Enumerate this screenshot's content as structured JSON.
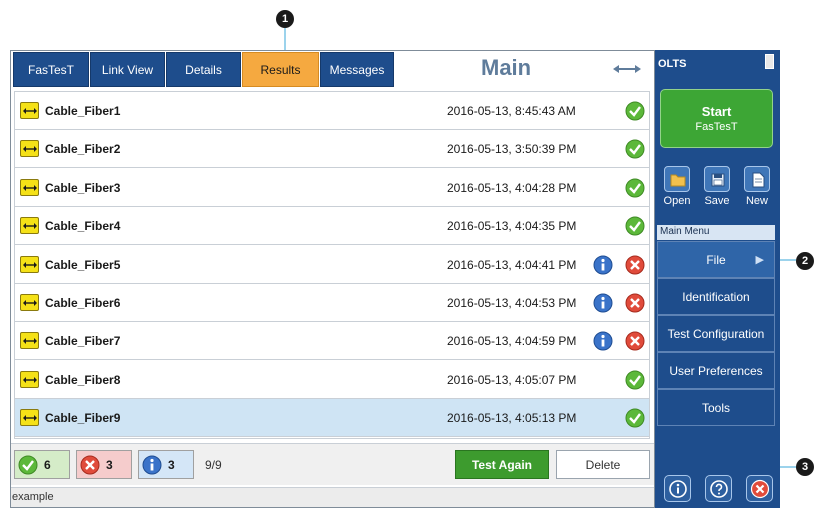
{
  "tabs": [
    {
      "label": "FasTesT"
    },
    {
      "label": "Link View"
    },
    {
      "label": "Details"
    },
    {
      "label": "Results"
    },
    {
      "label": "Messages"
    }
  ],
  "active_tab": "Results",
  "main_title": "Main",
  "results": [
    {
      "name": "Cable_Fiber1",
      "date": "2016-05-13, 8:45:43 AM",
      "status": "pass",
      "info": false
    },
    {
      "name": "Cable_Fiber2",
      "date": "2016-05-13, 3:50:39 PM",
      "status": "pass",
      "info": false
    },
    {
      "name": "Cable_Fiber3",
      "date": "2016-05-13, 4:04:28 PM",
      "status": "pass",
      "info": false
    },
    {
      "name": "Cable_Fiber4",
      "date": "2016-05-13, 4:04:35 PM",
      "status": "pass",
      "info": false
    },
    {
      "name": "Cable_Fiber5",
      "date": "2016-05-13, 4:04:41 PM",
      "status": "fail",
      "info": true
    },
    {
      "name": "Cable_Fiber6",
      "date": "2016-05-13, 4:04:53 PM",
      "status": "fail",
      "info": true
    },
    {
      "name": "Cable_Fiber7",
      "date": "2016-05-13, 4:04:59 PM",
      "status": "fail",
      "info": true
    },
    {
      "name": "Cable_Fiber8",
      "date": "2016-05-13, 4:05:07 PM",
      "status": "pass",
      "info": false
    },
    {
      "name": "Cable_Fiber9",
      "date": "2016-05-13, 4:05:13 PM",
      "status": "pass",
      "info": false,
      "selected": true
    }
  ],
  "footer": {
    "pass_count": "6",
    "fail_count": "3",
    "info_count": "3",
    "page_count": "9/9",
    "test_again_label": "Test Again",
    "delete_label": "Delete"
  },
  "status_line": "example",
  "sidebar": {
    "title": "OLTS",
    "start_label": "Start",
    "start_sublabel": "FasTesT",
    "tools": [
      {
        "label": "Open",
        "icon": "folder-open-icon"
      },
      {
        "label": "Save",
        "icon": "floppy-disk-icon"
      },
      {
        "label": "New",
        "icon": "new-document-icon"
      }
    ],
    "menu_header": "Main Menu",
    "menu_items": [
      {
        "label": "File"
      },
      {
        "label": "Identification"
      },
      {
        "label": "Test Configuration"
      },
      {
        "label": "User Preferences"
      },
      {
        "label": "Tools"
      }
    ]
  },
  "callouts": [
    "1",
    "2",
    "3"
  ],
  "colors": {
    "tab_blue": "#1e4d8c",
    "active_tab_orange": "#f5a940",
    "pass_green": "#5cb83a",
    "fail_red": "#e04b3b",
    "info_blue": "#3a73c9",
    "start_green": "#3da635",
    "selected_row": "#cfe4f4"
  }
}
